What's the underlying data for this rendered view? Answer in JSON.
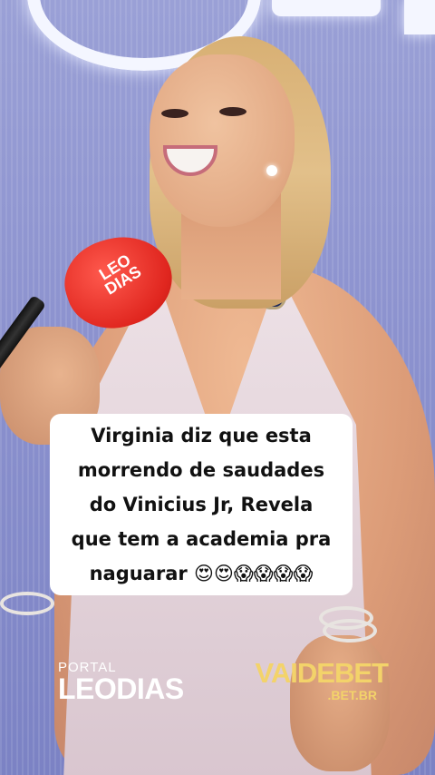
{
  "background": {
    "colors": {
      "wall": "#8d93cf",
      "dress": "#e3d3da",
      "mic": "#e0261f"
    }
  },
  "microphone": {
    "label": "LEO\nDIAS"
  },
  "caption": {
    "text": "Virginia diz que esta\nmorrendo de saudades\ndo Vinicius Jr, Revela\nque tem a academia pra\nnaguarar 😍😍😱😱😱😱"
  },
  "watermark_left": {
    "line1": "PORTAL",
    "line2": "LEODIAS"
  },
  "watermark_right": {
    "line1": "VAIDEBET",
    "line2": ".BET.BR"
  }
}
